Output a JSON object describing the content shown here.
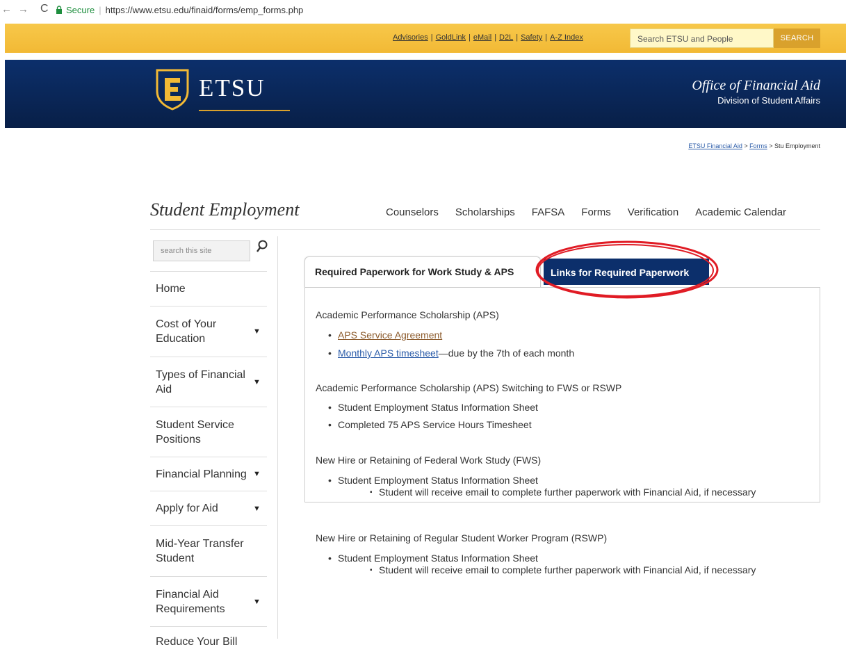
{
  "browser": {
    "back": "←",
    "forward": "→",
    "reload": "C",
    "secure_label": "Secure",
    "url": "https://www.etsu.edu/finaid/forms/emp_forms.php"
  },
  "utility": {
    "links": [
      "Advisories",
      "GoldLink",
      "eMail",
      "D2L",
      "Safety",
      "A-Z Index"
    ],
    "search_placeholder": "Search ETSU and People",
    "search_button": "SEARCH"
  },
  "header": {
    "logo_text": "ETSU",
    "office_title": "Office of Financial Aid",
    "office_subtitle": "Division of Student Affairs"
  },
  "breadcrumb": {
    "items": [
      "ETSU Financial Aid",
      "Forms"
    ],
    "current": "Stu Employment",
    "separator": ">"
  },
  "page": {
    "title": "Student Employment",
    "nav": [
      "Counselors",
      "Scholarships",
      "FAFSA",
      "Forms",
      "Verification",
      "Academic Calendar"
    ]
  },
  "sidebar": {
    "search_placeholder": "search this site",
    "items": [
      {
        "label": "Home",
        "caret": ""
      },
      {
        "label": "Cost of Your Education",
        "caret": "▼"
      },
      {
        "label": "Types of Financial Aid",
        "caret": "▼"
      },
      {
        "label": "Student Service Positions",
        "caret": ""
      },
      {
        "label": "Financial Planning",
        "caret": "▼"
      },
      {
        "label": "Apply for Aid",
        "caret": "▼"
      },
      {
        "label": "Mid-Year Transfer Student",
        "caret": ""
      },
      {
        "label": "Financial Aid Requirements",
        "caret": "▼"
      },
      {
        "label": "Reduce Your Bill",
        "caret": ""
      }
    ]
  },
  "tabs": {
    "tab1": "Required Paperwork for Work Study & APS",
    "tab2": "Links for Required Paperwork"
  },
  "content": {
    "s1_heading": "Academic Performance Scholarship (APS)",
    "s1_link1": "APS Service Agreement",
    "s1_link2": "Monthly APS timesheet",
    "s1_link2_suffix": "—due by the 7th of each month",
    "s2_heading": "Academic Performance Scholarship (APS) Switching to FWS or RSWP",
    "s2_item1": "Student Employment Status Information Sheet",
    "s2_item2": "Completed 75 APS Service Hours Timesheet",
    "s3_heading": "New Hire or Retaining of Federal Work Study (FWS)",
    "s3_item1": "Student Employment Status Information Sheet",
    "s3_sub1": "Student will receive email to complete further paperwork with Financial Aid, if necessary",
    "s4_heading": "New Hire or Retaining of Regular Student Worker Program (RSWP)",
    "s4_item1": "Student Employment Status Information Sheet",
    "s4_sub1": "Student will receive email to complete further paperwork with Financial Aid, if necessary"
  },
  "colors": {
    "gold": "#f2b935",
    "navy": "#0c2f6b",
    "highlight_circle": "#e01b24"
  }
}
